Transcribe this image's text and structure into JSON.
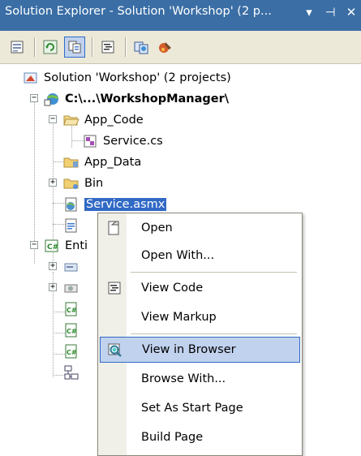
{
  "window": {
    "title": "Solution Explorer - Solution 'Workshop' (2 p...",
    "dropdown_glyph": "▾",
    "pin_glyph": "⊣",
    "close_glyph": "✕"
  },
  "toolbar": {
    "buttons": [
      "properties-icon",
      "refresh-icon",
      "show-all-files-icon",
      "view-code-icon",
      "copy-website-icon",
      "asp-net-config-icon"
    ]
  },
  "tree": {
    "solution": "Solution 'Workshop' (2 projects)",
    "project": "C:\\...\\WorkshopManager\\",
    "app_code": "App_Code",
    "service_cs": "Service.cs",
    "app_data": "App_Data",
    "bin": "Bin",
    "service_asmx": "Service.asmx",
    "enti_partial": "Enti"
  },
  "context_menu": {
    "items": [
      "Open",
      "Open With...",
      "View Code",
      "View Markup",
      "View in Browser",
      "Browse With...",
      "Set As Start Page",
      "Build Page"
    ],
    "highlighted": "View in Browser"
  },
  "colors": {
    "titlebar": "#3a6ea5",
    "selection": "#316ac5",
    "menu_highlight": "#c1d2ee"
  }
}
